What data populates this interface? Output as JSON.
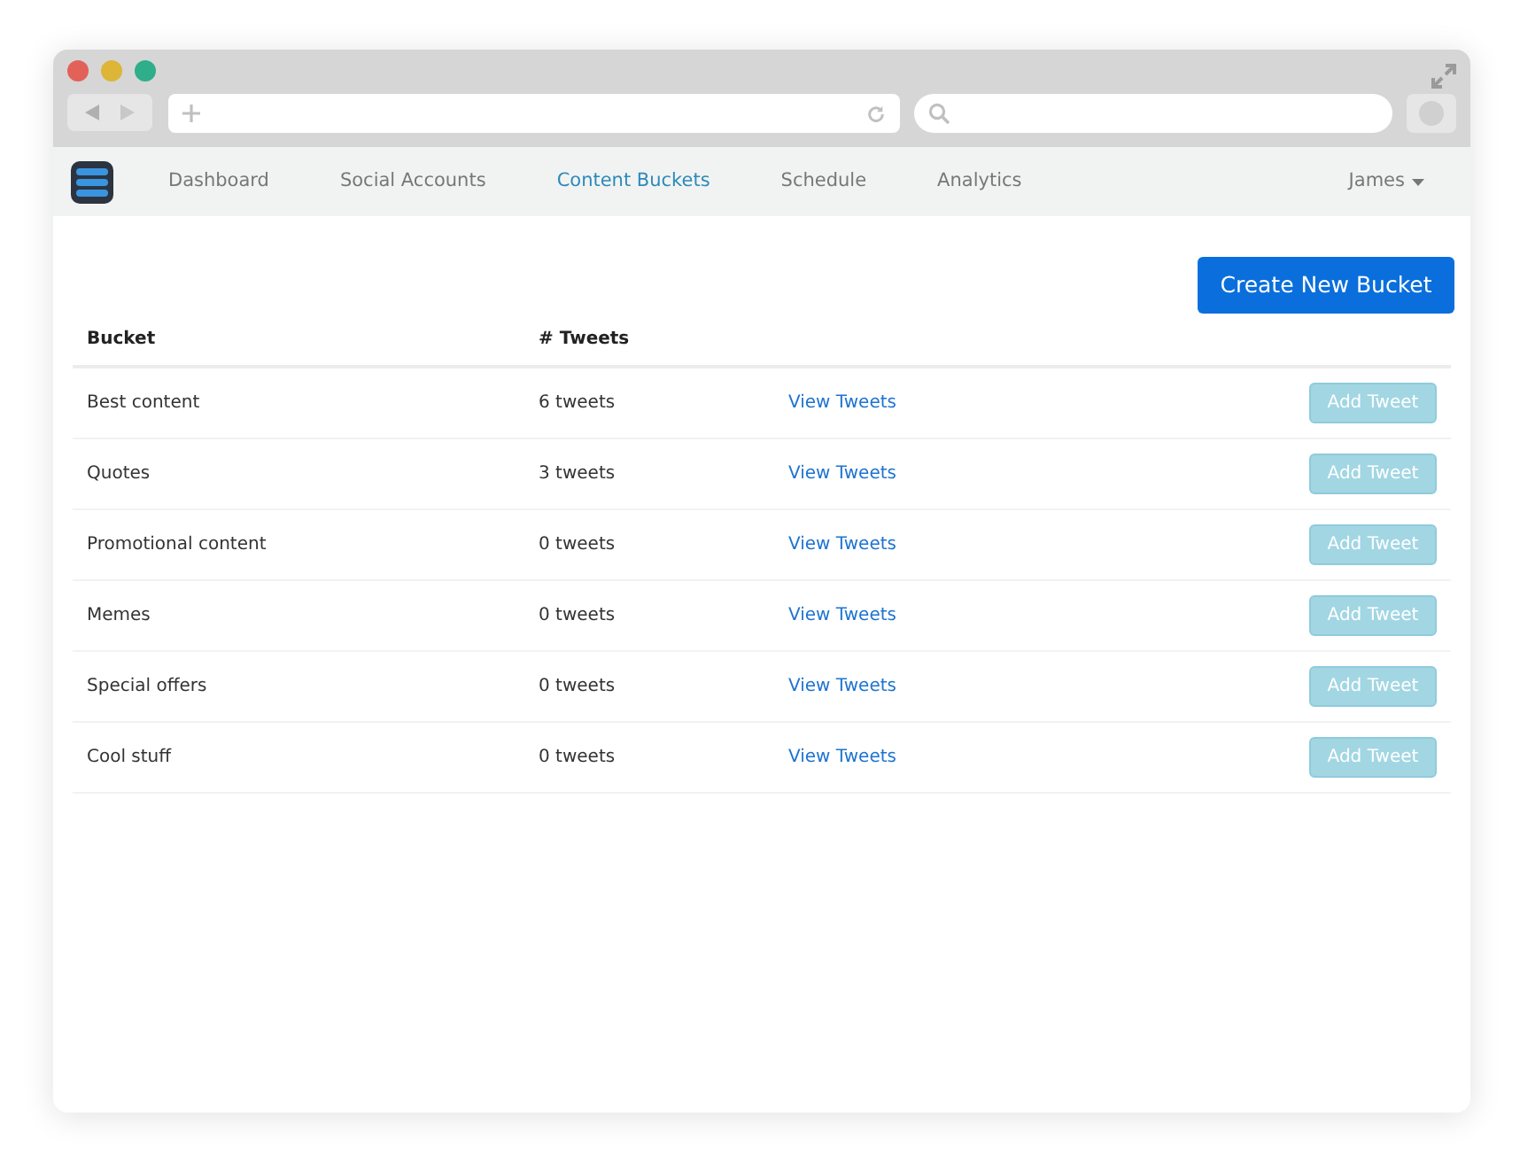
{
  "nav": {
    "items": [
      {
        "label": "Dashboard",
        "selected": false
      },
      {
        "label": "Social Accounts",
        "selected": false
      },
      {
        "label": "Content Buckets",
        "selected": true
      },
      {
        "label": "Schedule",
        "selected": false
      },
      {
        "label": "Analytics",
        "selected": false
      }
    ],
    "user": "James"
  },
  "create_button": "Create New Bucket",
  "table": {
    "columns": [
      "Bucket",
      "# Tweets"
    ],
    "rows": [
      {
        "bucket": "Best content",
        "tweets": "6 tweets",
        "link": "View Tweets",
        "action": "Add Tweet",
        "disabled": true
      },
      {
        "bucket": "Quotes",
        "tweets": "3 tweets",
        "link": "View Tweets",
        "action": "Add Tweet",
        "disabled": true
      },
      {
        "bucket": "Promotional content",
        "tweets": "0 tweets",
        "link": "View Tweets",
        "action": "Add Tweet",
        "disabled": true
      },
      {
        "bucket": "Memes",
        "tweets": "0 tweets",
        "link": "View Tweets",
        "action": "Add Tweet",
        "disabled": true
      },
      {
        "bucket": "Special offers",
        "tweets": "0 tweets",
        "link": "View Tweets",
        "action": "Add Tweet",
        "disabled": true
      },
      {
        "bucket": "Cool stuff",
        "tweets": "0 tweets",
        "link": "View Tweets",
        "action": "Add Tweet",
        "disabled": true
      }
    ]
  }
}
